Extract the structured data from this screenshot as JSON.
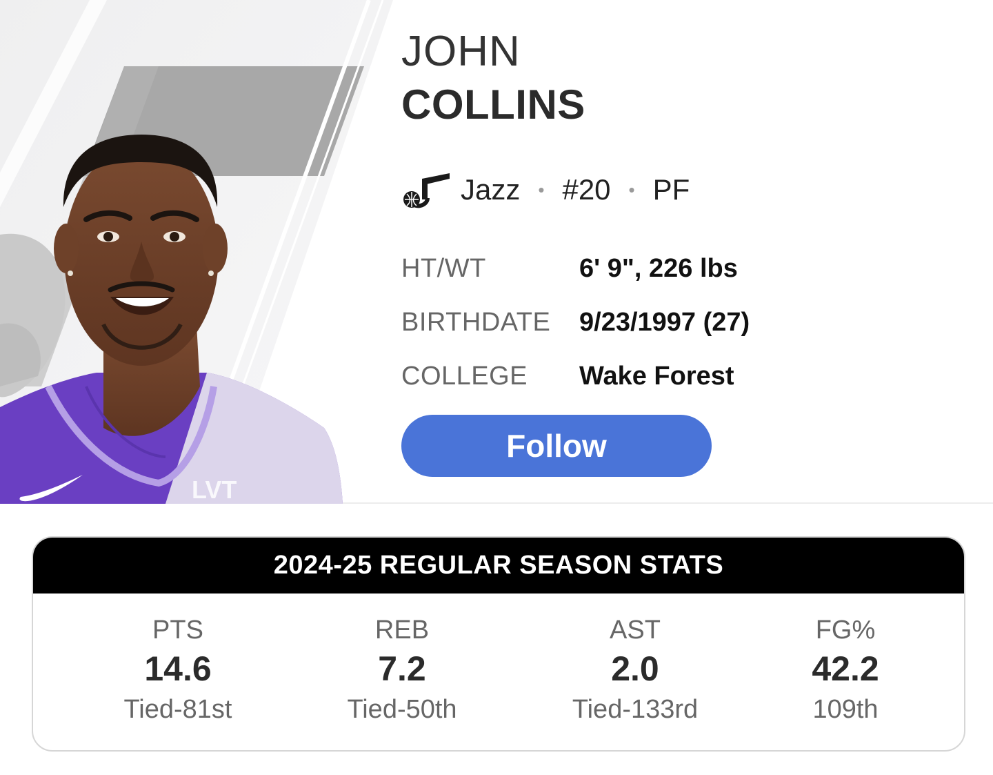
{
  "player": {
    "first_name": "JOHN",
    "last_name": "COLLINS",
    "team": "Jazz",
    "number": "#20",
    "position": "PF",
    "separator": "•"
  },
  "bio": [
    {
      "label": "HT/WT",
      "value": "6' 9\", 226 lbs"
    },
    {
      "label": "BIRTHDATE",
      "value": "9/23/1997 (27)"
    },
    {
      "label": "COLLEGE",
      "value": "Wake Forest"
    }
  ],
  "follow_button": {
    "label": "Follow"
  },
  "stats": {
    "title": "2024-25 REGULAR SEASON STATS",
    "items": [
      {
        "label": "PTS",
        "value": "14.6",
        "rank": "Tied-81st"
      },
      {
        "label": "REB",
        "value": "7.2",
        "rank": "Tied-50th"
      },
      {
        "label": "AST",
        "value": "2.0",
        "rank": "Tied-133rd"
      },
      {
        "label": "FG%",
        "value": "42.2",
        "rank": "109th"
      }
    ]
  },
  "colors": {
    "follow_button": "#4a74d8",
    "stats_header_bg": "#000000",
    "jersey": "#6a3fc2"
  },
  "icons": {
    "team_logo": "jazz-note-logo-icon",
    "jersey_brand": "swoosh-icon"
  },
  "jersey_text": "LVT"
}
